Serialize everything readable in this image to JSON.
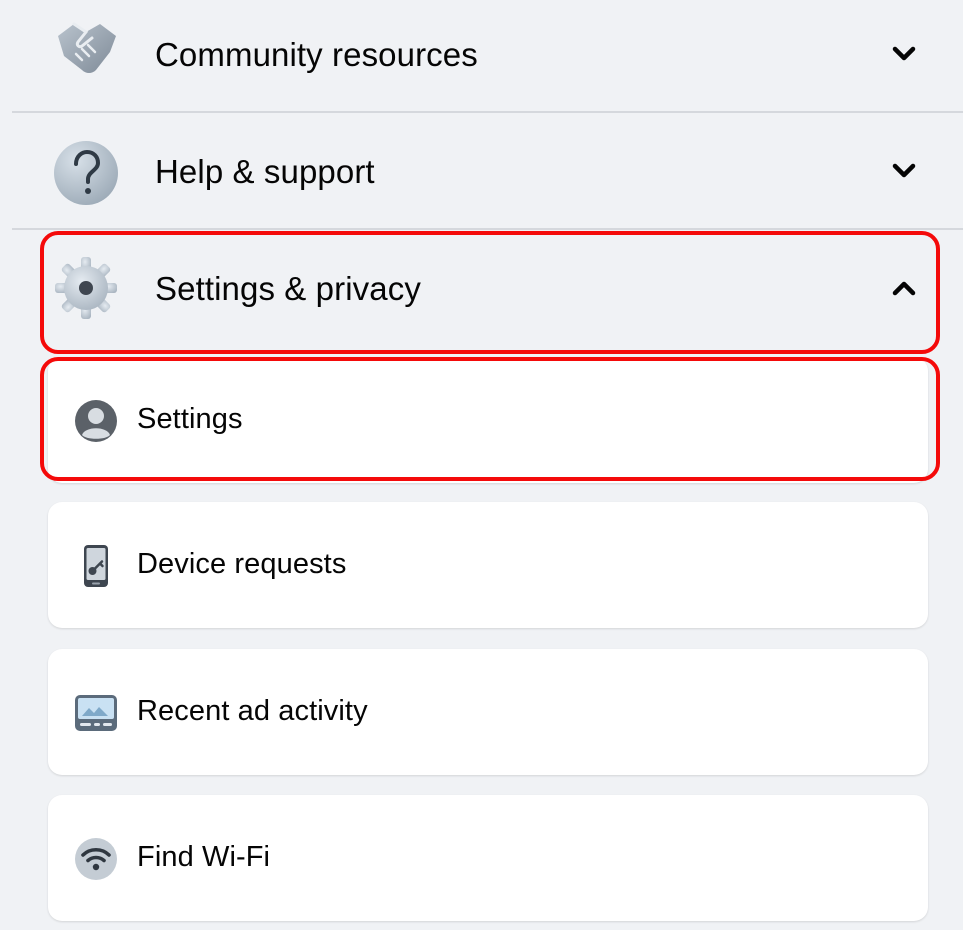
{
  "sections": [
    {
      "label": "Community resources",
      "icon": "handshake-icon",
      "state": "collapsed"
    },
    {
      "label": "Help & support",
      "icon": "question-mark-icon",
      "state": "collapsed"
    },
    {
      "label": "Settings & privacy",
      "icon": "gear-icon",
      "state": "expanded"
    }
  ],
  "settings_items": [
    {
      "label": "Settings",
      "icon": "profile-icon"
    },
    {
      "label": "Device requests",
      "icon": "phone-key-icon"
    },
    {
      "label": "Recent ad activity",
      "icon": "ad-image-icon"
    },
    {
      "label": "Find Wi-Fi",
      "icon": "wifi-icon"
    }
  ],
  "colors": {
    "background": "#f0f2f5",
    "card": "#ffffff",
    "highlight": "#f40a0a",
    "text": "#050505"
  }
}
